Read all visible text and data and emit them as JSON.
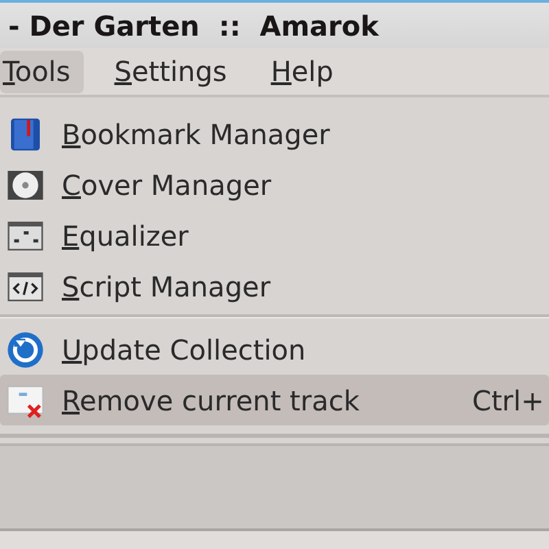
{
  "window": {
    "title": "- Der Garten  ::  Amarok"
  },
  "menubar": [
    {
      "label": "Tools",
      "selected": true
    },
    {
      "label": "Settings",
      "selected": false
    },
    {
      "label": "Help",
      "selected": false
    }
  ],
  "menu": {
    "groups": [
      [
        {
          "label": "Bookmark Manager",
          "selected": false
        },
        {
          "label": "Cover Manager",
          "selected": false
        },
        {
          "label": "Equalizer",
          "selected": false
        },
        {
          "label": "Script Manager",
          "selected": false
        }
      ],
      [
        {
          "label": "Update Collection",
          "selected": false
        },
        {
          "label": "Remove current track",
          "selected": true,
          "shortcut": "Ctrl+"
        }
      ]
    ]
  }
}
